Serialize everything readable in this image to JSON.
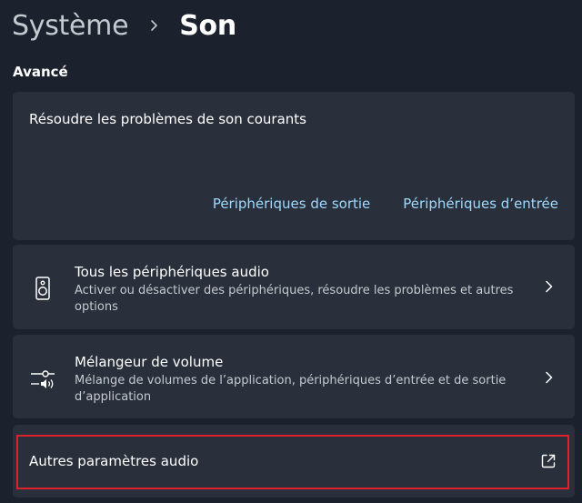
{
  "breadcrumb": {
    "parent": "Système",
    "current": "Son"
  },
  "section": {
    "title": "Avancé"
  },
  "troubleshoot": {
    "title": "Résoudre les problèmes de son courants",
    "links": {
      "output": "Périphériques de sortie",
      "input": "Périphériques d’entrée"
    }
  },
  "all_devices": {
    "icon": "speaker-icon",
    "title": "Tous les périphériques audio",
    "description": "Activer ou désactiver des périphériques, résoudre les problèmes et autres options"
  },
  "volume_mixer": {
    "icon": "mixer-volume-icon",
    "title": "Mélangeur de volume",
    "description": "Mélange de volumes de l’application, périphériques d’entrée et de sortie d’application"
  },
  "more_settings": {
    "icon": "external-link-icon",
    "title": "Autres paramètres audio"
  },
  "colors": {
    "background": "#1c222d",
    "card": "#2a303b",
    "link": "#9fd9ff",
    "highlight": "#e0202a"
  }
}
